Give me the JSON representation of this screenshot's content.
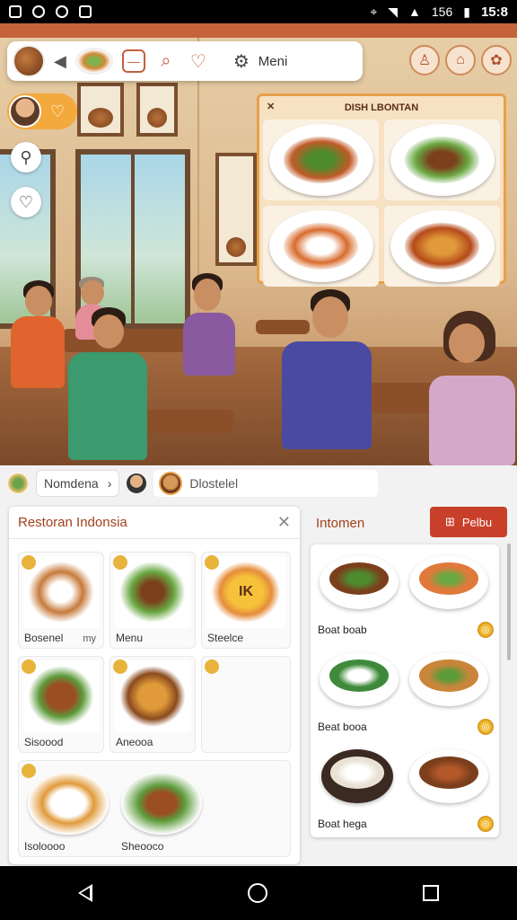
{
  "status_bar": {
    "battery": "156",
    "time": "15:8"
  },
  "toolbar": {
    "menu_label": "Meni"
  },
  "dish_board": {
    "title": "DISH LBONTAN"
  },
  "search": {
    "breadcrumb": "Nomdena",
    "query": "Dlostelel"
  },
  "left_panel": {
    "title": "Restoran Indonsia",
    "cards": [
      {
        "caption": "Bosenel",
        "mini": "my"
      },
      {
        "caption": "Menu"
      },
      {
        "caption": "Steelce",
        "overlay": "IK"
      },
      {
        "caption": "Sisoood"
      },
      {
        "caption": "Aneooa"
      },
      {
        "caption": ""
      },
      {
        "caption": "Isoloooo"
      },
      {
        "caption": "Sheooco"
      }
    ]
  },
  "right_panel": {
    "label": "Intomen",
    "button_label": "Pelbu",
    "items": [
      {
        "caption": "Boat boab"
      },
      {
        "caption": "Beat booa"
      },
      {
        "caption": "Boat hega"
      }
    ]
  },
  "colors": {
    "accent": "#c9402a",
    "heading": "#a1401c",
    "board_border": "#e7a049",
    "badge": "#e8b33b"
  },
  "icons": [
    "wifi-icon",
    "signal-icon",
    "battery-icon",
    "heart-icon",
    "map-pin-icon",
    "gear-icon",
    "close-icon",
    "chevron-right-icon",
    "back-icon",
    "home-icon",
    "recents-icon"
  ]
}
